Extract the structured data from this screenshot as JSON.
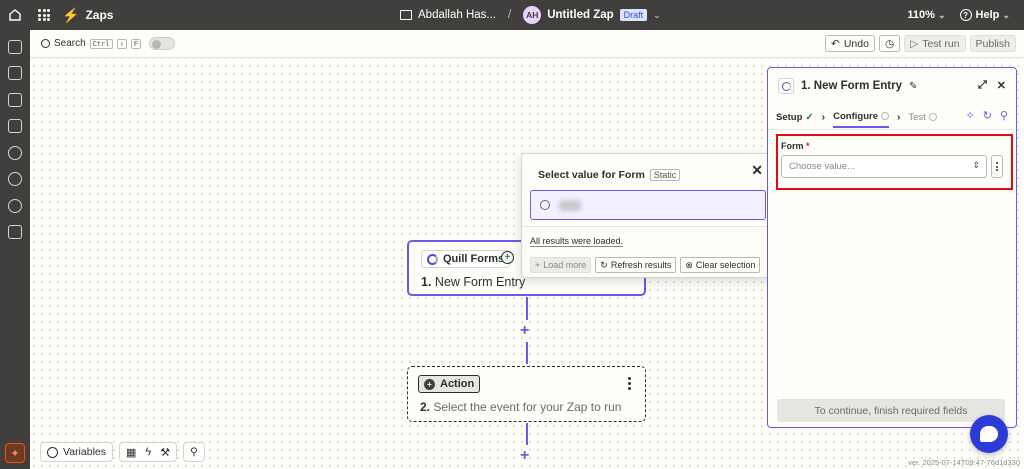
{
  "topbar": {
    "app_title": "Zaps",
    "folder_name": "Abdallah Has...",
    "avatar_initials": "AH",
    "zap_name": "Untitled Zap",
    "status": "Draft",
    "zoom": "110%",
    "help": "Help"
  },
  "toolbar": {
    "search_label": "Search",
    "shortcut_keys": [
      "Ctrl",
      "⇧",
      "F"
    ],
    "undo": "Undo",
    "test_run": "Test run",
    "publish": "Publish"
  },
  "trigger_node": {
    "app_name": "Quill Forms",
    "step_number": "1.",
    "title": "New Form Entry"
  },
  "action_node": {
    "badge": "Action",
    "step_number": "2.",
    "title": "Select the event for your Zap to run"
  },
  "popup": {
    "title": "Select value for Form",
    "tag": "Static",
    "status_text": "All results were loaded.",
    "load_more": "Load more",
    "refresh": "Refresh results",
    "clear": "Clear selection"
  },
  "panel": {
    "title": "1. New Form Entry",
    "tabs": [
      {
        "label": "Setup",
        "state": "done"
      },
      {
        "label": "Configure",
        "state": "active"
      },
      {
        "label": "Test",
        "state": "pending"
      }
    ],
    "field_label": "Form",
    "field_placeholder": "Choose value...",
    "continue_button": "To continue, finish required fields"
  },
  "bottom_bar": {
    "variables": "Variables"
  },
  "version": "ver. 2025-07-14T09:47-76d1d330",
  "colors": {
    "accent": "#695be8",
    "brand": "#ff4f00",
    "highlight": "#e50914",
    "chat": "#2c3bd6"
  }
}
